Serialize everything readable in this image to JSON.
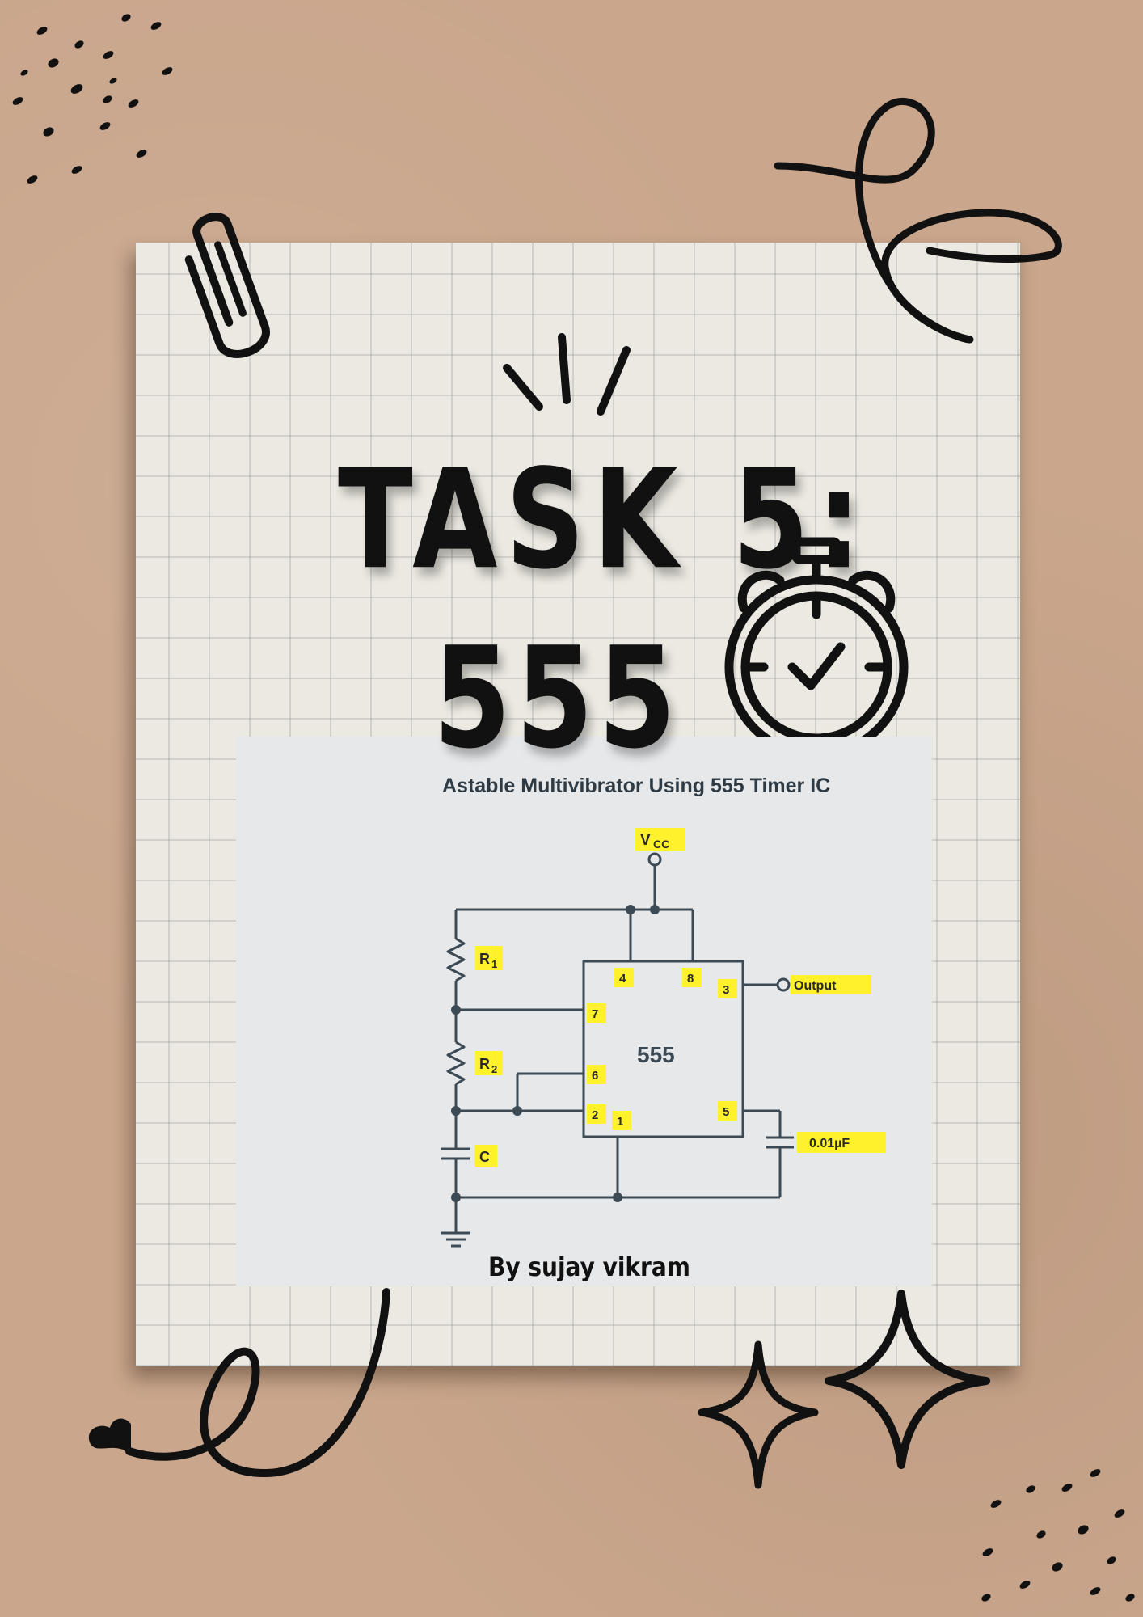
{
  "title": {
    "line1": "TASK 5:",
    "line2": "555"
  },
  "diagram": {
    "title": "Astable Multivibrator Using 555 Timer IC",
    "ic_label": "555",
    "supply_label": "V",
    "supply_subscript": "CC",
    "output_label": "Output",
    "capacitor_value": "0.01µF",
    "components": {
      "r1": {
        "letter": "R",
        "sub": "1"
      },
      "r2": {
        "letter": "R",
        "sub": "2"
      },
      "c": {
        "letter": "C"
      }
    },
    "pins": [
      "4",
      "8",
      "3",
      "7",
      "6",
      "2",
      "1",
      "5"
    ]
  },
  "author": "By sujay vikram",
  "colors": {
    "background": "#c9a68c",
    "paper": "#ebe9e1",
    "card": "#e6e8ea",
    "wire": "#3c4a55",
    "highlight": "#fff12b",
    "ink": "#111111"
  },
  "icons": [
    "paperclip-icon",
    "stopwatch-icon",
    "sparkle-icon",
    "loop-doodle-icon",
    "dots-icon"
  ]
}
